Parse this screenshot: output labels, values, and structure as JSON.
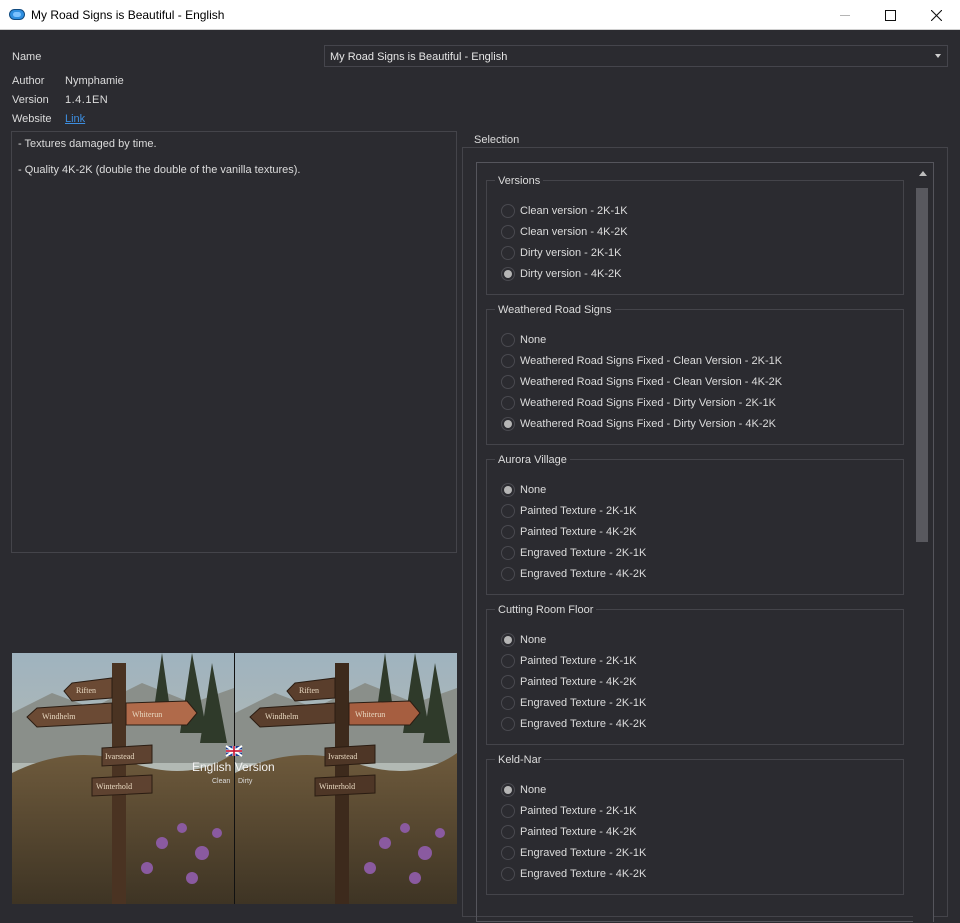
{
  "window": {
    "title": "My Road Signs is Beautiful - English"
  },
  "info": {
    "name_label": "Name",
    "name_value": "My Road Signs is Beautiful - English",
    "author_label": "Author",
    "author_value": "Nymphamie",
    "version_label": "Version",
    "version_value": "1.4.1EN",
    "website_label": "Website",
    "website_link": "Link"
  },
  "description": {
    "lines": [
      "- Textures damaged by time.",
      "- Quality 4K-2K (double the double of the vanilla textures)."
    ]
  },
  "preview": {
    "signs_left": [
      "Riften",
      "Windhelm",
      "Whiterun",
      "Ivarstead",
      "Winterhold"
    ],
    "signs_right": [
      "Riften",
      "Windhelm",
      "Whiterun",
      "Ivarstead",
      "Winterhold"
    ],
    "caption": "English Version",
    "sub_left": "Clean",
    "sub_right": "Dirty"
  },
  "selection": {
    "title": "Selection",
    "groups": [
      {
        "title": "Versions",
        "options": [
          "Clean version - 2K-1K",
          "Clean version - 4K-2K",
          "Dirty version - 2K-1K",
          "Dirty version - 4K-2K"
        ],
        "selected": 3
      },
      {
        "title": "Weathered Road Signs",
        "options": [
          "None",
          "Weathered Road Signs Fixed - Clean Version - 2K-1K",
          "Weathered Road Signs Fixed - Clean Version - 4K-2K",
          "Weathered Road Signs Fixed - Dirty Version - 2K-1K",
          "Weathered Road Signs Fixed - Dirty Version - 4K-2K"
        ],
        "selected": 4
      },
      {
        "title": "Aurora Village",
        "options": [
          "None",
          "Painted Texture - 2K-1K",
          "Painted Texture - 4K-2K",
          "Engraved Texture - 2K-1K",
          "Engraved Texture - 4K-2K"
        ],
        "selected": 0
      },
      {
        "title": "Cutting Room Floor",
        "options": [
          "None",
          "Painted Texture - 2K-1K",
          "Painted Texture - 4K-2K",
          "Engraved Texture - 2K-1K",
          "Engraved Texture - 4K-2K"
        ],
        "selected": 0
      },
      {
        "title": "Keld-Nar",
        "options": [
          "None",
          "Painted Texture - 2K-1K",
          "Painted Texture - 4K-2K",
          "Engraved Texture - 2K-1K",
          "Engraved Texture - 4K-2K"
        ],
        "selected": 0
      }
    ]
  },
  "colors": {
    "background": "#2b2b30",
    "link": "#3d8ee0",
    "border": "#44444a"
  }
}
